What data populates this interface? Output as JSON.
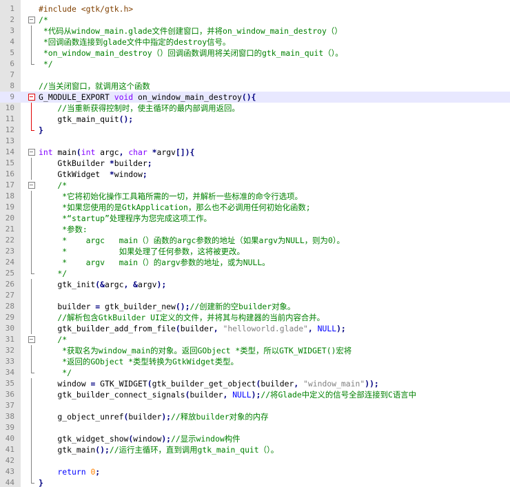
{
  "colors": {
    "comment": "#008000",
    "keyword": "#0000ff",
    "type": "#8000ff",
    "number": "#ff8000",
    "string": "#808080",
    "operator": "#000080",
    "preprocessor": "#804000",
    "current_line": "#e8e8ff",
    "gutter": "#e4e4e4",
    "fold_active": "#e00000"
  },
  "editor": {
    "current_line": 9,
    "lines": [
      {
        "n": "1",
        "fold": "",
        "tokens": [
          {
            "c": "p",
            "t": "#include <gtk/gtk.h>"
          }
        ]
      },
      {
        "n": "2",
        "fold": "box",
        "tokens": [
          {
            "c": "c",
            "t": "/*"
          }
        ]
      },
      {
        "n": "3",
        "fold": "mid",
        "tokens": [
          {
            "c": "c",
            "t": " *代码从window_main.glade文件创建窗口，并将on_window_main_destroy（）"
          }
        ]
      },
      {
        "n": "4",
        "fold": "mid",
        "tokens": [
          {
            "c": "c",
            "t": " *回调函数连接到glade文件中指定的destroy信号。"
          }
        ]
      },
      {
        "n": "5",
        "fold": "mid",
        "tokens": [
          {
            "c": "c",
            "t": " *on_window_main_destroy（）回调函数调用将关闭窗口的gtk_main_quit（）。"
          }
        ]
      },
      {
        "n": "6",
        "fold": "end",
        "tokens": [
          {
            "c": "c",
            "t": " */"
          }
        ]
      },
      {
        "n": "7",
        "fold": "",
        "tokens": []
      },
      {
        "n": "8",
        "fold": "",
        "tokens": [
          {
            "c": "c",
            "t": "//当关闭窗口，就调用这个函数"
          }
        ]
      },
      {
        "n": "9",
        "fold": "box red",
        "tokens": [
          {
            "c": "",
            "t": "G_MODULE_EXPORT "
          },
          {
            "c": "t",
            "t": "void"
          },
          {
            "c": "",
            "t": " on_window_main_destroy"
          },
          {
            "c": "o",
            "t": "(){"
          }
        ]
      },
      {
        "n": "10",
        "fold": "mid red",
        "tokens": [
          {
            "c": "c",
            "t": "    //当重新获得控制时，使主循环的最内部调用返回。"
          }
        ]
      },
      {
        "n": "11",
        "fold": "mid red",
        "tokens": [
          {
            "c": "",
            "t": "    gtk_main_quit"
          },
          {
            "c": "o",
            "t": "();"
          }
        ]
      },
      {
        "n": "12",
        "fold": "end red",
        "tokens": [
          {
            "c": "o",
            "t": "}"
          }
        ]
      },
      {
        "n": "13",
        "fold": "",
        "tokens": []
      },
      {
        "n": "14",
        "fold": "box",
        "tokens": [
          {
            "c": "t",
            "t": "int"
          },
          {
            "c": "",
            "t": " main"
          },
          {
            "c": "o",
            "t": "("
          },
          {
            "c": "t",
            "t": "int"
          },
          {
            "c": "",
            "t": " argc"
          },
          {
            "c": "o",
            "t": ", "
          },
          {
            "c": "t",
            "t": "char"
          },
          {
            "c": "",
            "t": " "
          },
          {
            "c": "o",
            "t": "*"
          },
          {
            "c": "",
            "t": "argv"
          },
          {
            "c": "o",
            "t": "[]){"
          }
        ]
      },
      {
        "n": "15",
        "fold": "mid",
        "tokens": [
          {
            "c": "",
            "t": "    GtkBuilder "
          },
          {
            "c": "o",
            "t": "*"
          },
          {
            "c": "",
            "t": "builder"
          },
          {
            "c": "o",
            "t": ";"
          }
        ]
      },
      {
        "n": "16",
        "fold": "mid",
        "tokens": [
          {
            "c": "",
            "t": "    GtkWidget  "
          },
          {
            "c": "o",
            "t": "*"
          },
          {
            "c": "",
            "t": "window"
          },
          {
            "c": "o",
            "t": ";"
          }
        ]
      },
      {
        "n": "17",
        "fold": "box",
        "tokens": [
          {
            "c": "c",
            "t": "    /*"
          }
        ]
      },
      {
        "n": "18",
        "fold": "mid",
        "tokens": [
          {
            "c": "c",
            "t": "     *它将初始化操作工具箱所需的一切，并解析一些标准的命令行选项。"
          }
        ]
      },
      {
        "n": "19",
        "fold": "mid",
        "tokens": [
          {
            "c": "c",
            "t": "     *如果您使用的是GtkApplication，那么也不必调用任何初始化函数;"
          }
        ]
      },
      {
        "n": "20",
        "fold": "mid",
        "tokens": [
          {
            "c": "c",
            "t": "     *“startup”处理程序为您完成这项工作。"
          }
        ]
      },
      {
        "n": "21",
        "fold": "mid",
        "tokens": [
          {
            "c": "c",
            "t": "     *参数:"
          }
        ]
      },
      {
        "n": "22",
        "fold": "mid",
        "tokens": [
          {
            "c": "c",
            "t": "     *    argc   main（）函数的argc参数的地址（如果argv为NULL，则为0）。"
          }
        ]
      },
      {
        "n": "23",
        "fold": "mid",
        "tokens": [
          {
            "c": "c",
            "t": "     *           如果处理了任何参数，这将被更改。"
          }
        ]
      },
      {
        "n": "24",
        "fold": "mid",
        "tokens": [
          {
            "c": "c",
            "t": "     *    argv   main（）的argv参数的地址，或为NULL。"
          }
        ]
      },
      {
        "n": "25",
        "fold": "end",
        "tokens": [
          {
            "c": "c",
            "t": "    */"
          }
        ]
      },
      {
        "n": "26",
        "fold": "mid",
        "tokens": [
          {
            "c": "",
            "t": "    gtk_init"
          },
          {
            "c": "o",
            "t": "(&"
          },
          {
            "c": "",
            "t": "argc"
          },
          {
            "c": "o",
            "t": ", &"
          },
          {
            "c": "",
            "t": "argv"
          },
          {
            "c": "o",
            "t": ");"
          }
        ]
      },
      {
        "n": "27",
        "fold": "mid",
        "tokens": []
      },
      {
        "n": "28",
        "fold": "mid",
        "tokens": [
          {
            "c": "",
            "t": "    builder "
          },
          {
            "c": "o",
            "t": "="
          },
          {
            "c": "",
            "t": " gtk_builder_new"
          },
          {
            "c": "o",
            "t": "();"
          },
          {
            "c": "c",
            "t": "//创建新的空builder对象。"
          }
        ]
      },
      {
        "n": "29",
        "fold": "mid",
        "tokens": [
          {
            "c": "c",
            "t": "    //解析包含GtkBuilder UI定义的文件，并将其与构建器的当前内容合并。"
          }
        ]
      },
      {
        "n": "30",
        "fold": "mid",
        "tokens": [
          {
            "c": "",
            "t": "    gtk_builder_add_from_file"
          },
          {
            "c": "o",
            "t": "("
          },
          {
            "c": "",
            "t": "builder"
          },
          {
            "c": "o",
            "t": ", "
          },
          {
            "c": "s",
            "t": "\"helloworld.glade\""
          },
          {
            "c": "o",
            "t": ", "
          },
          {
            "c": "k",
            "t": "NULL"
          },
          {
            "c": "o",
            "t": ");"
          }
        ]
      },
      {
        "n": "31",
        "fold": "box",
        "tokens": [
          {
            "c": "c",
            "t": "    /*"
          }
        ]
      },
      {
        "n": "32",
        "fold": "mid",
        "tokens": [
          {
            "c": "c",
            "t": "     *获取名为window_main的对象。返回GObject *类型，所以GTK_WIDGET()宏将"
          }
        ]
      },
      {
        "n": "33",
        "fold": "mid",
        "tokens": [
          {
            "c": "c",
            "t": "     *返回的GObject *类型转换为GtkWidget类型。"
          }
        ]
      },
      {
        "n": "34",
        "fold": "end",
        "tokens": [
          {
            "c": "c",
            "t": "     */"
          }
        ]
      },
      {
        "n": "35",
        "fold": "mid",
        "tokens": [
          {
            "c": "",
            "t": "    window "
          },
          {
            "c": "o",
            "t": "="
          },
          {
            "c": "",
            "t": " GTK_WIDGET"
          },
          {
            "c": "o",
            "t": "("
          },
          {
            "c": "",
            "t": "gtk_builder_get_object"
          },
          {
            "c": "o",
            "t": "("
          },
          {
            "c": "",
            "t": "builder"
          },
          {
            "c": "o",
            "t": ", "
          },
          {
            "c": "s",
            "t": "\"window_main\""
          },
          {
            "c": "o",
            "t": "));"
          }
        ]
      },
      {
        "n": "36",
        "fold": "mid",
        "tokens": [
          {
            "c": "",
            "t": "    gtk_builder_connect_signals"
          },
          {
            "c": "o",
            "t": "("
          },
          {
            "c": "",
            "t": "builder"
          },
          {
            "c": "o",
            "t": ", "
          },
          {
            "c": "k",
            "t": "NULL"
          },
          {
            "c": "o",
            "t": ");"
          },
          {
            "c": "c",
            "t": "//将Glade中定义的信号全部连接到C语言中"
          }
        ]
      },
      {
        "n": "37",
        "fold": "mid",
        "tokens": []
      },
      {
        "n": "38",
        "fold": "mid",
        "tokens": [
          {
            "c": "",
            "t": "    g_object_unref"
          },
          {
            "c": "o",
            "t": "("
          },
          {
            "c": "",
            "t": "builder"
          },
          {
            "c": "o",
            "t": ");"
          },
          {
            "c": "c",
            "t": "//释放builder对象的内存"
          }
        ]
      },
      {
        "n": "39",
        "fold": "mid",
        "tokens": []
      },
      {
        "n": "40",
        "fold": "mid",
        "tokens": [
          {
            "c": "",
            "t": "    gtk_widget_show"
          },
          {
            "c": "o",
            "t": "("
          },
          {
            "c": "",
            "t": "window"
          },
          {
            "c": "o",
            "t": ");"
          },
          {
            "c": "c",
            "t": "//显示window构件"
          }
        ]
      },
      {
        "n": "41",
        "fold": "mid",
        "tokens": [
          {
            "c": "",
            "t": "    gtk_main"
          },
          {
            "c": "o",
            "t": "();"
          },
          {
            "c": "c",
            "t": "//运行主循环，直到调用gtk_main_quit（）。"
          }
        ]
      },
      {
        "n": "42",
        "fold": "mid",
        "tokens": []
      },
      {
        "n": "43",
        "fold": "mid",
        "tokens": [
          {
            "c": "k",
            "t": "    return"
          },
          {
            "c": "",
            "t": " "
          },
          {
            "c": "n",
            "t": "0"
          },
          {
            "c": "o",
            "t": ";"
          }
        ]
      },
      {
        "n": "44",
        "fold": "end",
        "tokens": [
          {
            "c": "o",
            "t": "}"
          }
        ]
      }
    ]
  }
}
